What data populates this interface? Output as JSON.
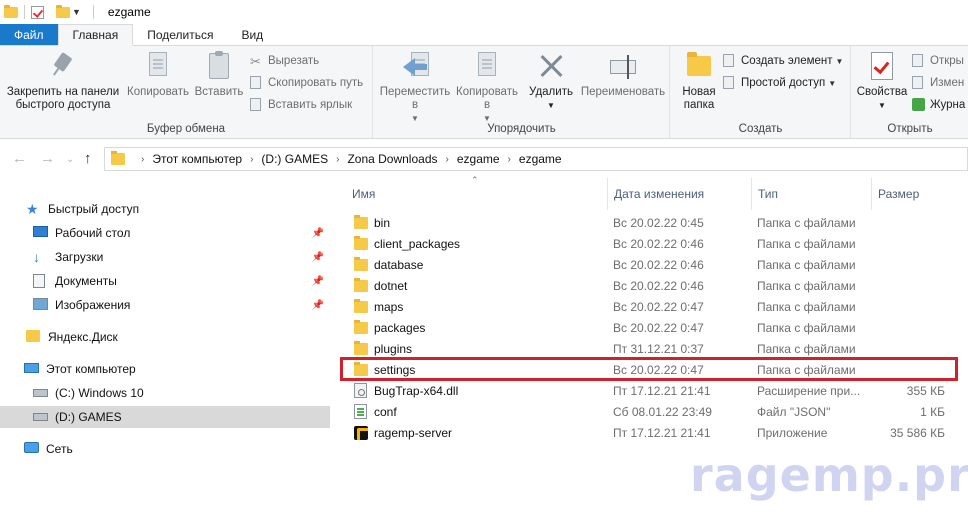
{
  "window": {
    "title": "ezgame"
  },
  "tabs": [
    "Файл",
    "Главная",
    "Поделиться",
    "Вид"
  ],
  "ribbon": {
    "clipboard": {
      "label": "Буфер обмена",
      "pin": "Закрепить на панели быстрого доступа",
      "copy": "Копировать",
      "paste": "Вставить",
      "cut": "Вырезать",
      "copy_path": "Скопировать путь",
      "paste_shortcut": "Вставить ярлык"
    },
    "organize": {
      "label": "Упорядочить",
      "move_to": "Переместить в",
      "copy_to": "Копировать в",
      "delete": "Удалить",
      "rename": "Переименовать"
    },
    "create": {
      "label": "Создать",
      "new_folder": "Новая папка",
      "new_item": "Создать элемент",
      "easy_access": "Простой доступ"
    },
    "open": {
      "label": "Открыть",
      "properties": "Свойства",
      "open": "Откры",
      "edit": "Измен",
      "history": "Журна"
    }
  },
  "address": {
    "crumbs": [
      "Этот компьютер",
      "(D:) GAMES",
      "Zona Downloads",
      "ezgame",
      "ezgame"
    ]
  },
  "navpane": {
    "quick_access": "Быстрый доступ",
    "desktop": "Рабочий стол",
    "downloads": "Загрузки",
    "documents": "Документы",
    "pictures": "Изображения",
    "yandex_disk": "Яндекс.Диск",
    "this_pc": "Этот компьютер",
    "drive_c": "(C:) Windows 10",
    "drive_d": "(D:) GAMES",
    "network": "Сеть"
  },
  "columns": {
    "name": "Имя",
    "date": "Дата изменения",
    "type": "Тип",
    "size": "Размер"
  },
  "files": [
    {
      "name": "bin",
      "date": "Вс 20.02.22 0:45",
      "type": "Папка с файлами",
      "size": "",
      "icon": "folder-icon"
    },
    {
      "name": "client_packages",
      "date": "Вс 20.02.22 0:46",
      "type": "Папка с файлами",
      "size": "",
      "icon": "folder-icon"
    },
    {
      "name": "database",
      "date": "Вс 20.02.22 0:46",
      "type": "Папка с файлами",
      "size": "",
      "icon": "folder-icon"
    },
    {
      "name": "dotnet",
      "date": "Вс 20.02.22 0:46",
      "type": "Папка с файлами",
      "size": "",
      "icon": "folder-icon"
    },
    {
      "name": "maps",
      "date": "Вс 20.02.22 0:47",
      "type": "Папка с файлами",
      "size": "",
      "icon": "folder-icon"
    },
    {
      "name": "packages",
      "date": "Вс 20.02.22 0:47",
      "type": "Папка с файлами",
      "size": "",
      "icon": "folder-icon"
    },
    {
      "name": "plugins",
      "date": "Пт 31.12.21 0:37",
      "type": "Папка с файлами",
      "size": "",
      "icon": "folder-icon"
    },
    {
      "name": "settings",
      "date": "Вс 20.02.22 0:47",
      "type": "Папка с файлами",
      "size": "",
      "icon": "folder-icon"
    },
    {
      "name": "BugTrap-x64.dll",
      "date": "Пт 17.12.21 21:41",
      "type": "Расширение при...",
      "size": "355 КБ",
      "icon": "dll-icon"
    },
    {
      "name": "conf",
      "date": "Сб 08.01.22 23:49",
      "type": "Файл \"JSON\"",
      "size": "1 КБ",
      "icon": "json-file-icon"
    },
    {
      "name": "ragemp-server",
      "date": "Пт 17.12.21 21:41",
      "type": "Приложение",
      "size": "35 586 КБ",
      "icon": "ragemp-app-icon"
    }
  ],
  "watermark": "ragemp.pro",
  "colors": {
    "file_tab": "#1979ca",
    "highlight": "#d0222a",
    "selected_nav": "#d9d9d9"
  }
}
